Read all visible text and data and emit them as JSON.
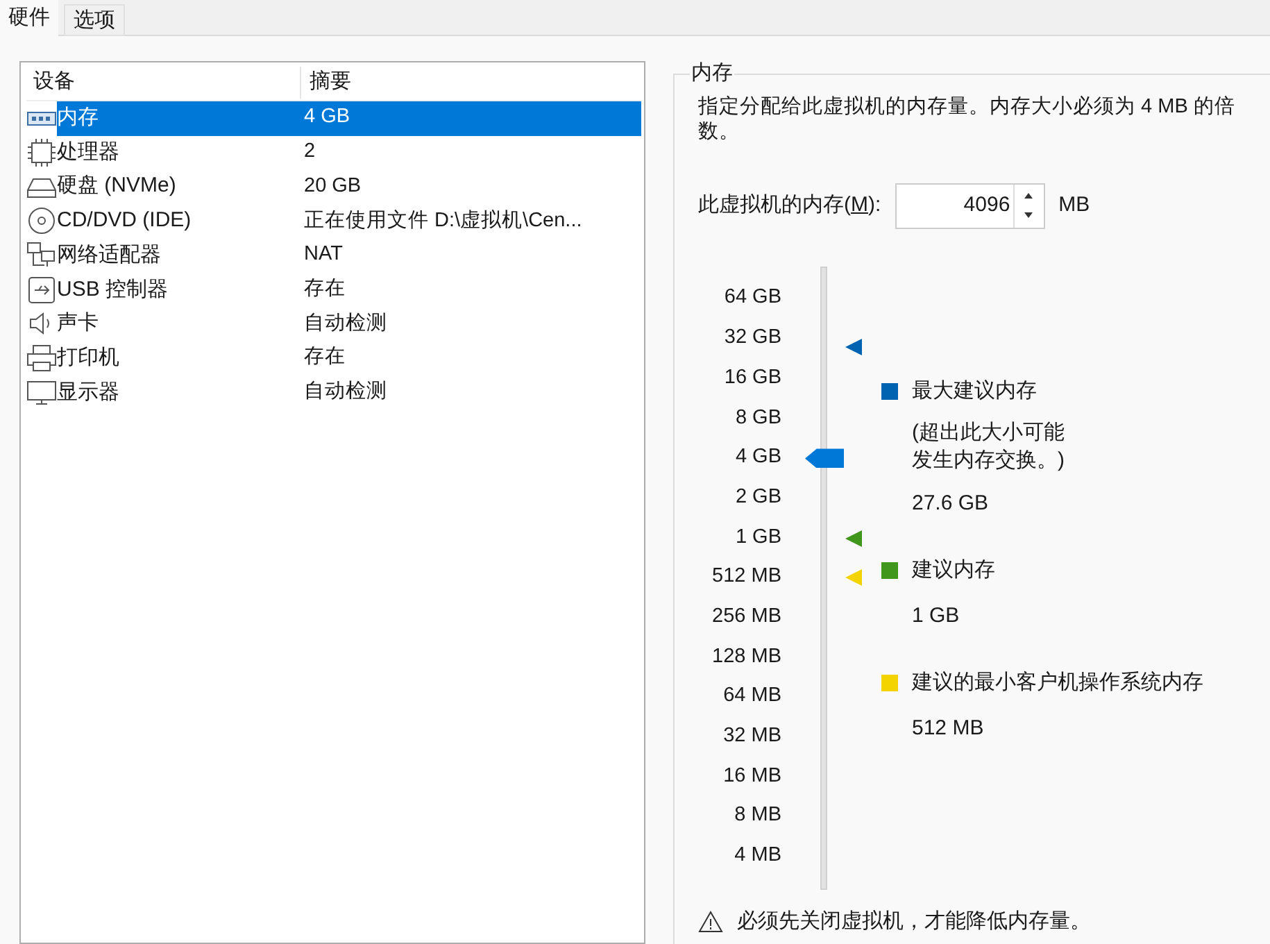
{
  "tabs": [
    {
      "label": "硬件",
      "selected": true
    },
    {
      "label": "选项",
      "selected": false
    }
  ],
  "device_table": {
    "columns": [
      "设备",
      "摘要"
    ],
    "rows": [
      {
        "kind": "memory",
        "device": "内存",
        "summary": "4 GB",
        "selected": true
      },
      {
        "kind": "cpu",
        "device": "处理器",
        "summary": "2",
        "selected": false
      },
      {
        "kind": "disk",
        "device": "硬盘 (NVMe)",
        "summary": "20 GB",
        "selected": false
      },
      {
        "kind": "cd",
        "device": "CD/DVD (IDE)",
        "summary": "正在使用文件 D:\\虚拟机\\Cen...",
        "selected": false
      },
      {
        "kind": "network",
        "device": "网络适配器",
        "summary": "NAT",
        "selected": false
      },
      {
        "kind": "usb",
        "device": "USB 控制器",
        "summary": "存在",
        "selected": false
      },
      {
        "kind": "sound",
        "device": "声卡",
        "summary": "自动检测",
        "selected": false
      },
      {
        "kind": "printer",
        "device": "打印机",
        "summary": "存在",
        "selected": false
      },
      {
        "kind": "display",
        "device": "显示器",
        "summary": "自动检测",
        "selected": false
      }
    ]
  },
  "memory_panel": {
    "title": "内存",
    "description": "指定分配给此虚拟机的内存量。内存大小必须为 4 MB 的倍数。",
    "memory_label": "此虚拟机的内存(",
    "memory_mnemonic": "M",
    "memory_label_end": "):",
    "memory_value": "4096",
    "memory_unit": "MB",
    "slider": {
      "ticks": [
        "64 GB",
        "32 GB",
        "16 GB",
        "8 GB",
        "4 GB",
        "2 GB",
        "1 GB",
        "512 MB",
        "256 MB",
        "128 MB",
        "64 MB",
        "32 MB",
        "16 MB",
        "8 MB",
        "4 MB"
      ],
      "level": 0.714,
      "markers": [
        {
          "level": 0.914
        },
        {
          "level": 0.571
        },
        {
          "level": 0.5
        }
      ]
    },
    "legend": [
      {
        "label": "最大建议内存",
        "note_lines": [
          "(超出此大小可能",
          "发生内存交换。)"
        ],
        "value": "27.6 GB",
        "color": "#0063b1"
      },
      {
        "label": "建议内存",
        "value": "1 GB",
        "color": "#41961c"
      },
      {
        "label": "建议的最小客户机操作系统内存",
        "value": "512 MB",
        "color": "#f4d400"
      }
    ],
    "warning": "必须先关闭虚拟机，才能降低内存量。"
  }
}
